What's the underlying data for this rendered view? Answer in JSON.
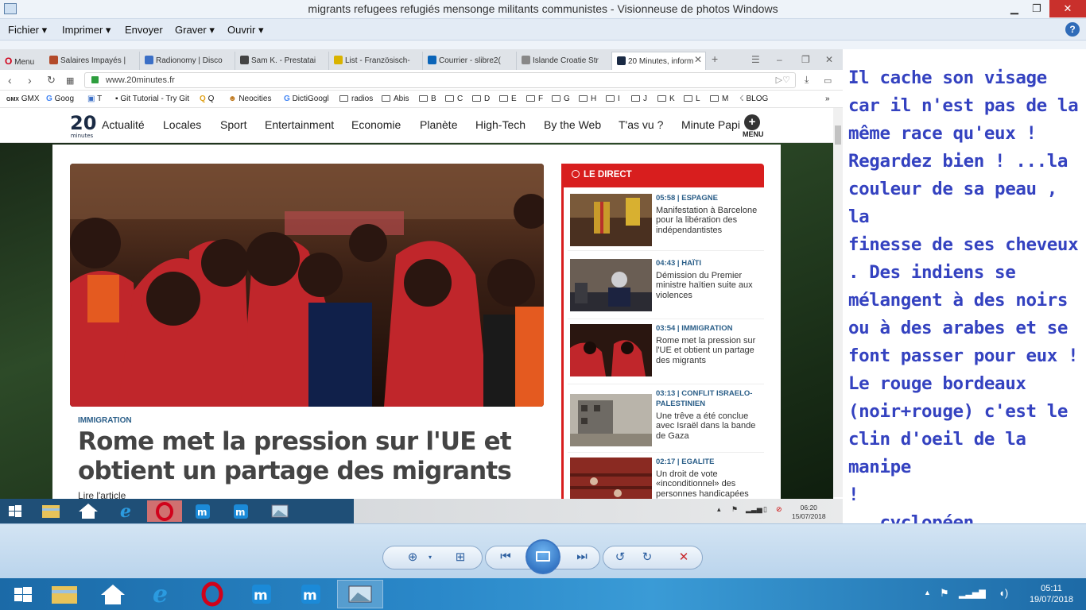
{
  "viewer": {
    "title": "migrants refugees refugiés mensonge militants communistes - Visionneuse de photos Windows",
    "menu": [
      "Fichier",
      "Imprimer",
      "Envoyer",
      "Graver",
      "Ouvrir"
    ],
    "menu_dropdown": [
      true,
      true,
      false,
      true,
      true
    ]
  },
  "browser": {
    "opera_menu": "Menu",
    "tabs": [
      {
        "label": "Salaires Impayés |",
        "color": "#b34a2a"
      },
      {
        "label": "Radionomy | Disco",
        "color": "#3b6fc6"
      },
      {
        "label": "Sam K. - Prestatai",
        "color": "#444444"
      },
      {
        "label": "List - Französisch-",
        "color": "#d9b300"
      },
      {
        "label": "Courrier - slibre2(",
        "color": "#0a64b8"
      },
      {
        "label": "Islande Croatie Str",
        "color": "#888888"
      },
      {
        "label": "20 Minutes, inform",
        "color": "#1a2a44"
      }
    ],
    "url": "www.20minutes.fr",
    "bookmarks": [
      "GMX",
      "Goog",
      "T",
      "Git Tutorial - Try Git",
      "Q",
      "Neocities",
      "DictiGoogl",
      "radios",
      "Abis",
      "B",
      "C",
      "D",
      "E",
      "F",
      "G",
      "H",
      "I",
      "J",
      "K",
      "L",
      "M",
      "BLOG"
    ]
  },
  "site": {
    "logo_main": "20",
    "logo_sub": "minutes",
    "nav": [
      "Actualité",
      "Locales",
      "Sport",
      "Entertainment",
      "Economie",
      "Planète",
      "High-Tech",
      "By the Web",
      "T'as vu ?",
      "Minute Papi"
    ],
    "menu_label": "MENU",
    "menu_icon": "+",
    "article": {
      "category": "IMMIGRATION",
      "headline": "Rome met la pression sur l'UE et obtient un partage des migrants",
      "read_more": "Lire l'article"
    },
    "direct": {
      "title": "LE DIRECT",
      "items": [
        {
          "time": "05:58 | ESPAGNE",
          "text": "Manifestation à Barcelone pour la libération des indépendantistes"
        },
        {
          "time": "04:43 | HAÏTI",
          "text": "Démission du Premier ministre haïtien suite aux violences"
        },
        {
          "time": "03:54 | IMMIGRATION",
          "text": "Rome met la pression sur l'UE et obtient un partage des migrants"
        },
        {
          "time": "03:13 | CONFLIT ISRAELO-PALESTINIEN",
          "text": "Une trêve a été conclue avec Israël dans la bande de Gaza"
        },
        {
          "time": "02:17 | EGALITE",
          "text": "Un droit de vote «inconditionnel» des personnes handicapées"
        }
      ]
    }
  },
  "inner_taskbar": {
    "time": "06:20",
    "date": "15/07/2018"
  },
  "caption": {
    "lines": [
      "Il cache son visage",
      "car il n'est pas de la",
      "même race qu'eux !",
      "Regardez bien ! ...la",
      "couleur de sa peau , la",
      "finesse de ses cheveux",
      ". Des indiens se",
      "mélangent à des noirs",
      "ou à des arabes et se",
      "font passer pour eux !",
      "Le rouge bordeaux",
      "(noir+rouge) c'est le",
      "clin d'oeil de la manipe",
      "!",
      "...cyclopéen"
    ]
  },
  "taskbar": {
    "time": "05:11",
    "date": "19/07/2018"
  },
  "colors": {
    "accent_red": "#d81e1e",
    "caption_blue": "#3442c0",
    "category_blue": "#2a5e88"
  }
}
